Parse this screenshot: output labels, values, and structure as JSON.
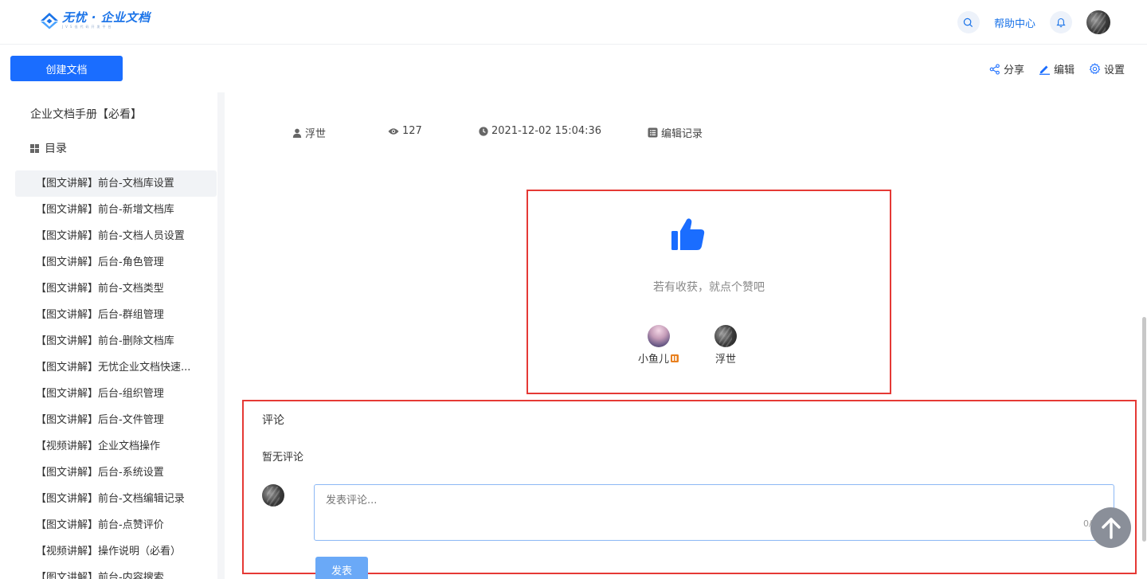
{
  "header": {
    "logo_text": "无忧 · 企业文档",
    "logo_sub": "JVS低代码开发平台",
    "help_label": "帮助中心",
    "search_icon": "search-icon",
    "bell_icon": "bell-icon"
  },
  "toolbar": {
    "create_label": "创建文档",
    "share_label": "分享",
    "edit_label": "编辑",
    "settings_label": "设置"
  },
  "sidebar": {
    "manual_title": "企业文档手册【必看】",
    "toc_label": "目录",
    "items": [
      {
        "label": "【图文讲解】前台-文档库设置",
        "active": true
      },
      {
        "label": "【图文讲解】前台-新增文档库"
      },
      {
        "label": "【图文讲解】前台-文档人员设置"
      },
      {
        "label": "【图文讲解】后台-角色管理"
      },
      {
        "label": "【图文讲解】前台-文档类型"
      },
      {
        "label": "【图文讲解】后台-群组管理"
      },
      {
        "label": "【图文讲解】前台-删除文档库"
      },
      {
        "label": "【图文讲解】无忧企业文档快速..."
      },
      {
        "label": "【图文讲解】后台-组织管理"
      },
      {
        "label": "【图文讲解】后台-文件管理"
      },
      {
        "label": "【视频讲解】企业文档操作"
      },
      {
        "label": "【图文讲解】后台-系统设置"
      },
      {
        "label": "【图文讲解】前台-文档编辑记录"
      },
      {
        "label": "【图文讲解】前台-点赞评价"
      },
      {
        "label": "【视频讲解】操作说明（必看）"
      },
      {
        "label": "【图文讲解】前台-内容搜索"
      }
    ]
  },
  "meta": {
    "author": "浮世",
    "views": "127",
    "datetime": "2021-12-02 15:04:36",
    "history_label": "编辑记录"
  },
  "like": {
    "prompt": "若有收获，就点个赞吧",
    "likers": [
      {
        "name": "小鱼儿"
      },
      {
        "name": "浮世"
      }
    ]
  },
  "comments": {
    "title": "评论",
    "empty_text": "暂无评论",
    "placeholder": "发表评论...",
    "counter": "0/",
    "post_label": "发表"
  },
  "colors": {
    "primary": "#1a6dff",
    "highlight_border": "#e53935"
  }
}
